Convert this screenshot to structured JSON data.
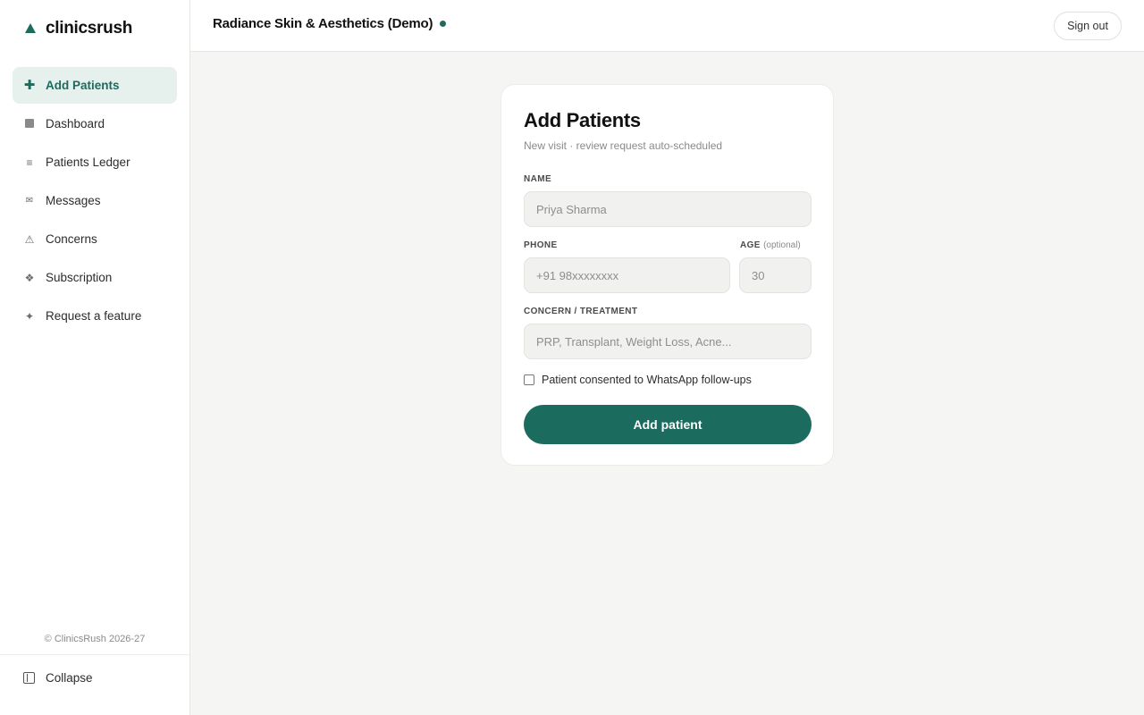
{
  "brand": {
    "name": "clinicsrush",
    "icon": "triangle-logo-icon",
    "color": "#1b6b5f"
  },
  "sidebar": {
    "items": [
      {
        "label": "Add Patients",
        "icon": "plus-icon",
        "active": true
      },
      {
        "label": "Dashboard",
        "icon": "square-icon"
      },
      {
        "label": "Patients Ledger",
        "icon": "list-icon"
      },
      {
        "label": "Messages",
        "icon": "envelope-icon"
      },
      {
        "label": "Concerns",
        "icon": "warning-icon"
      },
      {
        "label": "Subscription",
        "icon": "diamond-icon"
      },
      {
        "label": "Request a feature",
        "icon": "sparkle-icon"
      }
    ],
    "copyright": "© ClinicsRush 2026-27",
    "collapse_label": "Collapse"
  },
  "header": {
    "clinic_name": "Radiance Skin & Aesthetics (Demo)",
    "signout_label": "Sign out"
  },
  "form": {
    "title": "Add Patients",
    "subtitle": "New visit · review request auto-scheduled",
    "name_label": "NAME",
    "name_placeholder": "Priya Sharma",
    "phone_label": "PHONE",
    "phone_placeholder": "+91 98xxxxxxxx",
    "age_label": "AGE",
    "age_optional": "(optional)",
    "age_placeholder": "30",
    "concern_label": "CONCERN / TREATMENT",
    "concern_placeholder": "PRP, Transplant, Weight Loss, Acne...",
    "consent_label": "Patient consented to WhatsApp follow-ups",
    "consent_checked": false,
    "submit_label": "Add patient"
  },
  "colors": {
    "accent": "#1b6b5f",
    "active_bg": "#e6f0ec",
    "page_bg": "#f5f5f3"
  }
}
